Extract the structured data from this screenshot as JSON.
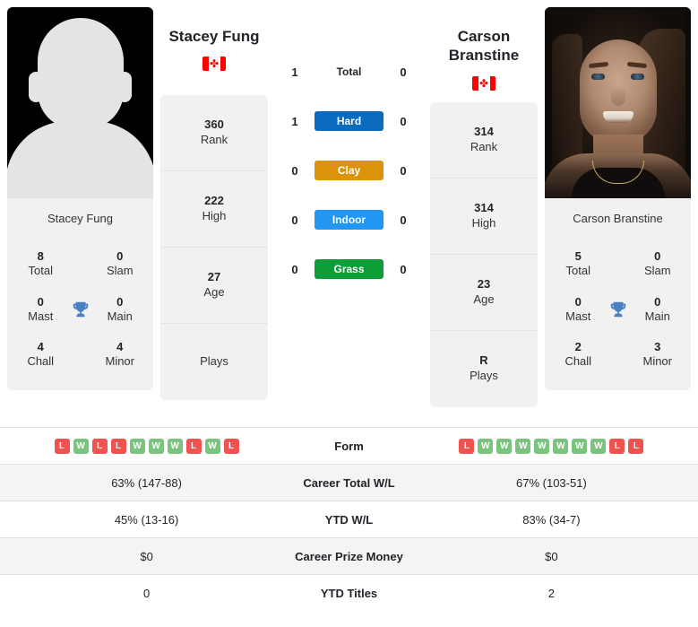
{
  "players": {
    "left": {
      "name": "Stacey Fung",
      "photo_caption": "Stacey Fung",
      "country": "Canada",
      "photo_type": "silhouette-placeholder",
      "titles": {
        "total_value": "8",
        "total_label": "Total",
        "slam_value": "0",
        "slam_label": "Slam",
        "mast_value": "0",
        "mast_label": "Mast",
        "main_value": "0",
        "main_label": "Main",
        "chall_value": "4",
        "chall_label": "Chall",
        "minor_value": "4",
        "minor_label": "Minor"
      },
      "info": [
        {
          "value": "360",
          "label": "Rank"
        },
        {
          "value": "222",
          "label": "High"
        },
        {
          "value": "27",
          "label": "Age"
        },
        {
          "value": "",
          "label": "Plays"
        }
      ]
    },
    "right": {
      "name": "Carson Branstine",
      "photo_caption": "Carson Branstine",
      "country": "Canada",
      "photo_type": "portrait",
      "titles": {
        "total_value": "5",
        "total_label": "Total",
        "slam_value": "0",
        "slam_label": "Slam",
        "mast_value": "0",
        "mast_label": "Mast",
        "main_value": "0",
        "main_label": "Main",
        "chall_value": "2",
        "chall_label": "Chall",
        "minor_value": "3",
        "minor_label": "Minor"
      },
      "info": [
        {
          "value": "314",
          "label": "Rank"
        },
        {
          "value": "314",
          "label": "High"
        },
        {
          "value": "23",
          "label": "Age"
        },
        {
          "value": "R",
          "label": "Plays"
        }
      ]
    }
  },
  "head_to_head": [
    {
      "label": "Total",
      "left": "1",
      "right": "0",
      "surface": false,
      "color": ""
    },
    {
      "label": "Hard",
      "left": "1",
      "right": "0",
      "surface": true,
      "color": "#0b6bbf"
    },
    {
      "label": "Clay",
      "left": "0",
      "right": "0",
      "surface": true,
      "color": "#dd9309"
    },
    {
      "label": "Indoor",
      "left": "0",
      "right": "0",
      "surface": true,
      "color": "#2196f3"
    },
    {
      "label": "Grass",
      "left": "0",
      "right": "0",
      "surface": true,
      "color": "#0f9d38"
    }
  ],
  "comparison_rows": [
    {
      "label": "Form",
      "type": "form",
      "left_form": [
        "L",
        "W",
        "L",
        "L",
        "W",
        "W",
        "W",
        "L",
        "W",
        "L"
      ],
      "right_form": [
        "L",
        "W",
        "W",
        "W",
        "W",
        "W",
        "W",
        "W",
        "L",
        "L"
      ],
      "alt": false
    },
    {
      "label": "Career Total W/L",
      "type": "text",
      "left": "63% (147-88)",
      "right": "67% (103-51)",
      "alt": true
    },
    {
      "label": "YTD W/L",
      "type": "text",
      "left": "45% (13-16)",
      "right": "83% (34-7)",
      "alt": false
    },
    {
      "label": "Career Prize Money",
      "type": "text",
      "left": "$0",
      "right": "$0",
      "alt": true
    },
    {
      "label": "YTD Titles",
      "type": "text",
      "left": "0",
      "right": "2",
      "alt": false
    }
  ],
  "icons": {
    "trophy": "trophy-icon",
    "flag": "canada-flag-icon",
    "maple_leaf": "✤"
  },
  "colors": {
    "hard": "#0b6bbf",
    "clay": "#dd9309",
    "indoor": "#2196f3",
    "grass": "#0f9d38",
    "win": "#7ac47f",
    "loss": "#ef5350",
    "trophy": "#4a7fc1",
    "card_bg": "#f1f1f1"
  }
}
